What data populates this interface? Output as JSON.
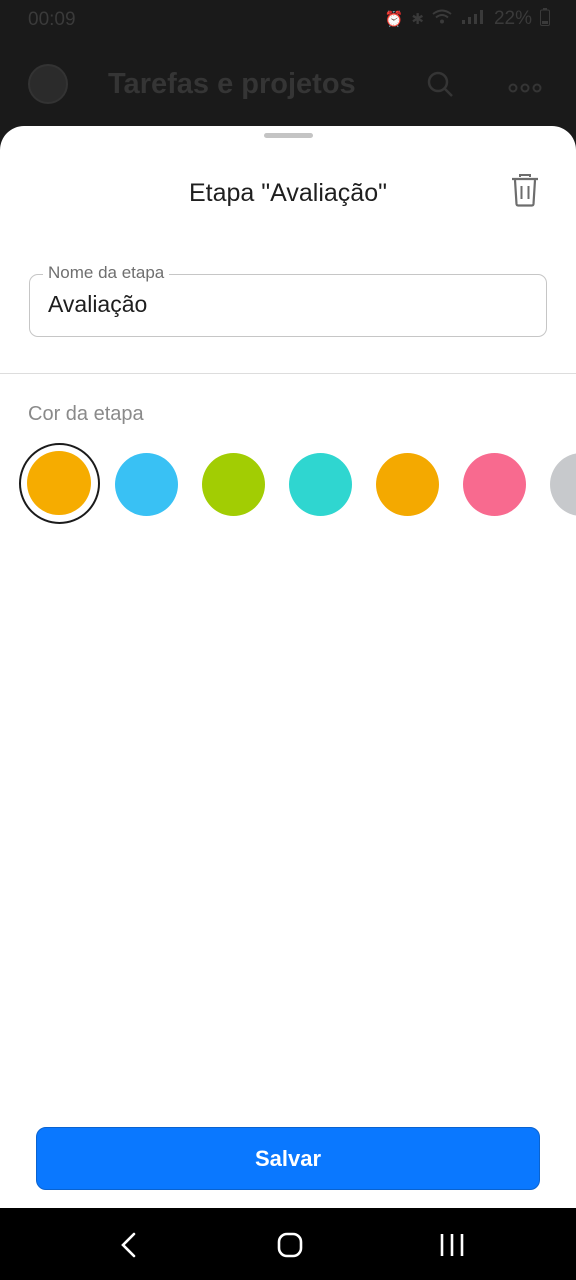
{
  "status_bar": {
    "time": "00:09",
    "battery": "22%",
    "icons": [
      "alarm-icon",
      "bluetooth-icon",
      "wifi-icon",
      "signal-icon",
      "battery-icon"
    ]
  },
  "background": {
    "title": "Tarefas e projetos",
    "icons": [
      "avatar",
      "search-icon",
      "more-icon"
    ]
  },
  "sheet": {
    "title": "Etapa \"Avaliação\"",
    "delete_icon": "trash-icon",
    "name_field": {
      "label": "Nome da etapa",
      "value": "Avaliação"
    },
    "color_section_label": "Cor da etapa",
    "colors": [
      "#f6ac00",
      "#39c1f4",
      "#a2cd03",
      "#2fd6d0",
      "#f4a900",
      "#f86a8f",
      "#c7c9cc"
    ],
    "selected_color_index": 0,
    "save_label": "Salvar"
  },
  "navbar": {
    "buttons": [
      "back-icon",
      "home-icon",
      "recents-icon"
    ]
  },
  "colors": {
    "primary": "#0a78ff",
    "sheet_background": "#ffffff",
    "overlay": "#1a1a1a"
  }
}
